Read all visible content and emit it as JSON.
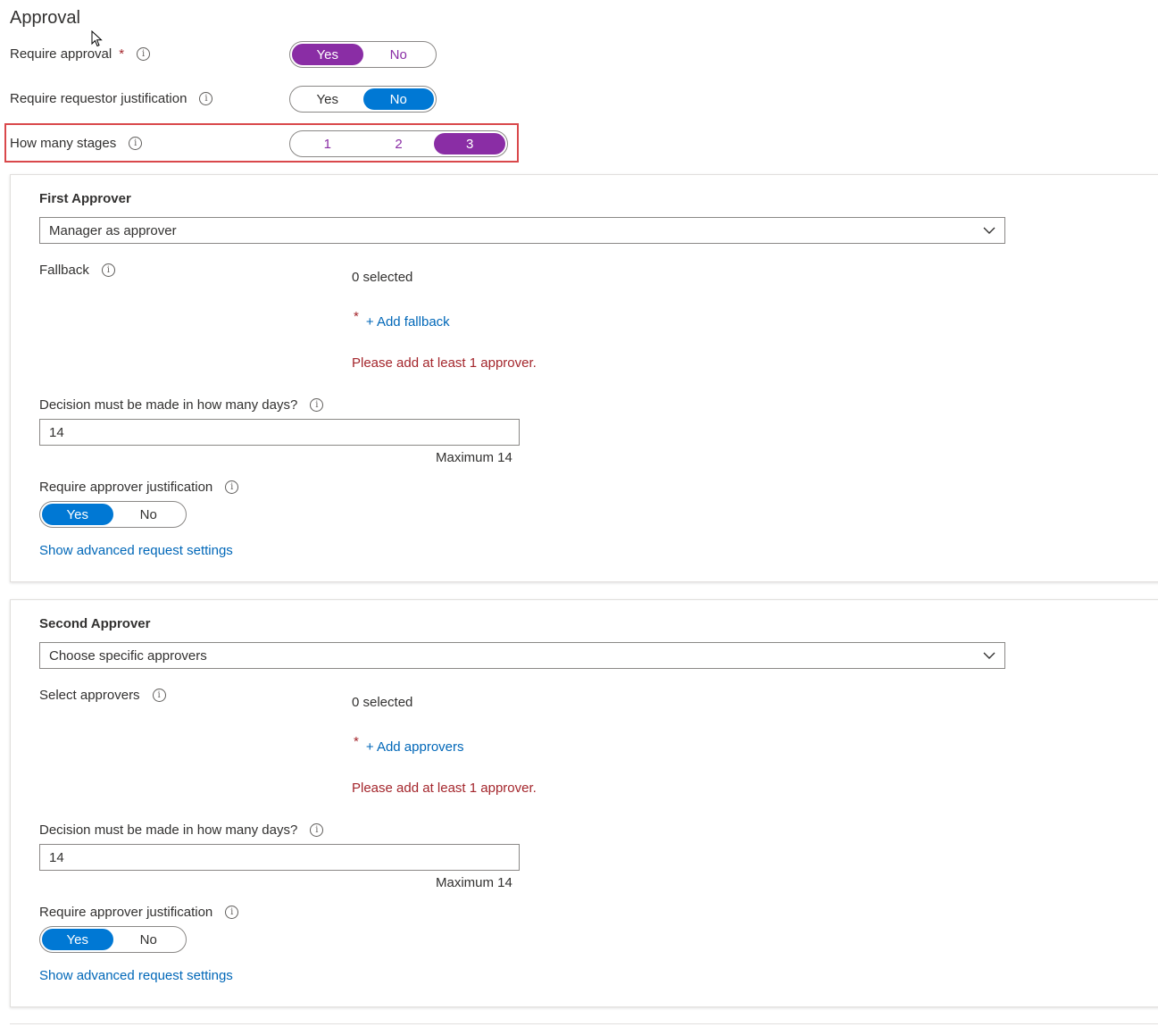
{
  "title": "Approval",
  "require_approval": {
    "label": "Require approval",
    "options": [
      "Yes",
      "No"
    ],
    "selected": 0
  },
  "require_requestor_justification": {
    "label": "Require requestor justification",
    "options": [
      "Yes",
      "No"
    ],
    "selected": 1
  },
  "stages": {
    "label": "How many stages",
    "options": [
      "1",
      "2",
      "3"
    ],
    "selected": 2
  },
  "info_glyph": "i",
  "required_marker": "*",
  "colors": {
    "purple": "#8a2da5",
    "blue": "#0078d4",
    "link": "#0067b8",
    "error": "#a4262c",
    "highlight": "#d9484b"
  },
  "approvers": [
    {
      "title": "First Approver",
      "dropdown_value": "Manager as approver",
      "people_label": "Fallback",
      "selected_count": "0 selected",
      "add_link": "+ Add fallback",
      "error": "Please add at least 1 approver.",
      "days_label": "Decision must be made in how many days?",
      "days_value": "14",
      "days_max": "Maximum 14",
      "justification_label": "Require approver justification",
      "justification_options": [
        "Yes",
        "No"
      ],
      "justification_selected": 0,
      "advanced_link": "Show advanced request settings"
    },
    {
      "title": "Second Approver",
      "dropdown_value": "Choose specific approvers",
      "people_label": "Select approvers",
      "selected_count": "0 selected",
      "add_link": "+ Add approvers",
      "error": "Please add at least 1 approver.",
      "days_label": "Decision must be made in how many days?",
      "days_value": "14",
      "days_max": "Maximum 14",
      "justification_label": "Require approver justification",
      "justification_options": [
        "Yes",
        "No"
      ],
      "justification_selected": 0,
      "advanced_link": "Show advanced request settings"
    }
  ]
}
